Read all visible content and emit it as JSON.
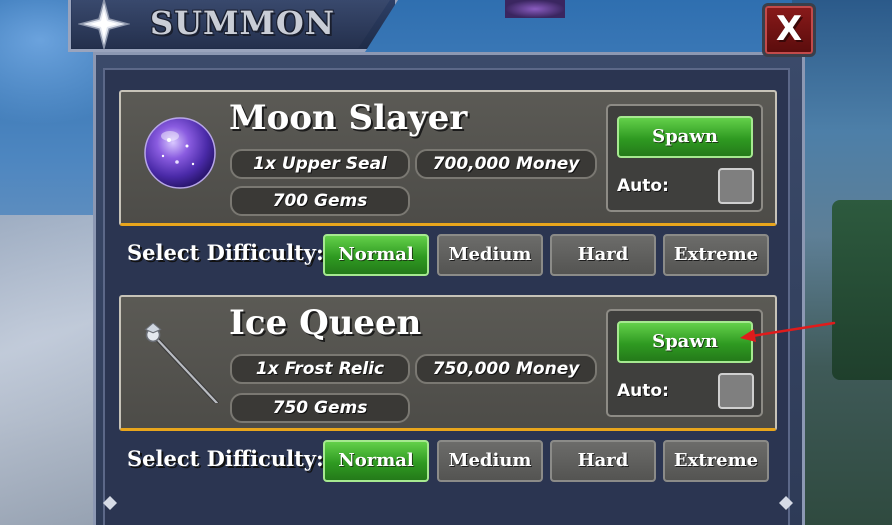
{
  "window": {
    "title": "SUMMON",
    "close_label": "X"
  },
  "bosses": [
    {
      "name": "Moon Slayer",
      "requirements": [
        "1x Upper Seal",
        "700,000 Money",
        "700 Gems"
      ],
      "spawn_label": "Spawn",
      "auto_label": "Auto:",
      "auto_checked": false,
      "icon": "purple-orb-icon",
      "difficulty_label": "Select Difficulty:",
      "difficulties": [
        "Normal",
        "Medium",
        "Hard",
        "Extreme"
      ],
      "selected_difficulty": "Normal"
    },
    {
      "name": "Ice Queen",
      "requirements": [
        "1x Frost Relic",
        "750,000 Money",
        "750 Gems"
      ],
      "spawn_label": "Spawn",
      "auto_label": "Auto:",
      "auto_checked": false,
      "icon": "ice-staff-icon",
      "difficulty_label": "Select Difficulty:",
      "difficulties": [
        "Normal",
        "Medium",
        "Hard",
        "Extreme"
      ],
      "selected_difficulty": "Normal"
    }
  ],
  "colors": {
    "active_green": "#2f9a21",
    "card_gold_border": "#e8a51c",
    "close_red": "#8a1a1a",
    "annotation_arrow": "#e01b1b"
  }
}
